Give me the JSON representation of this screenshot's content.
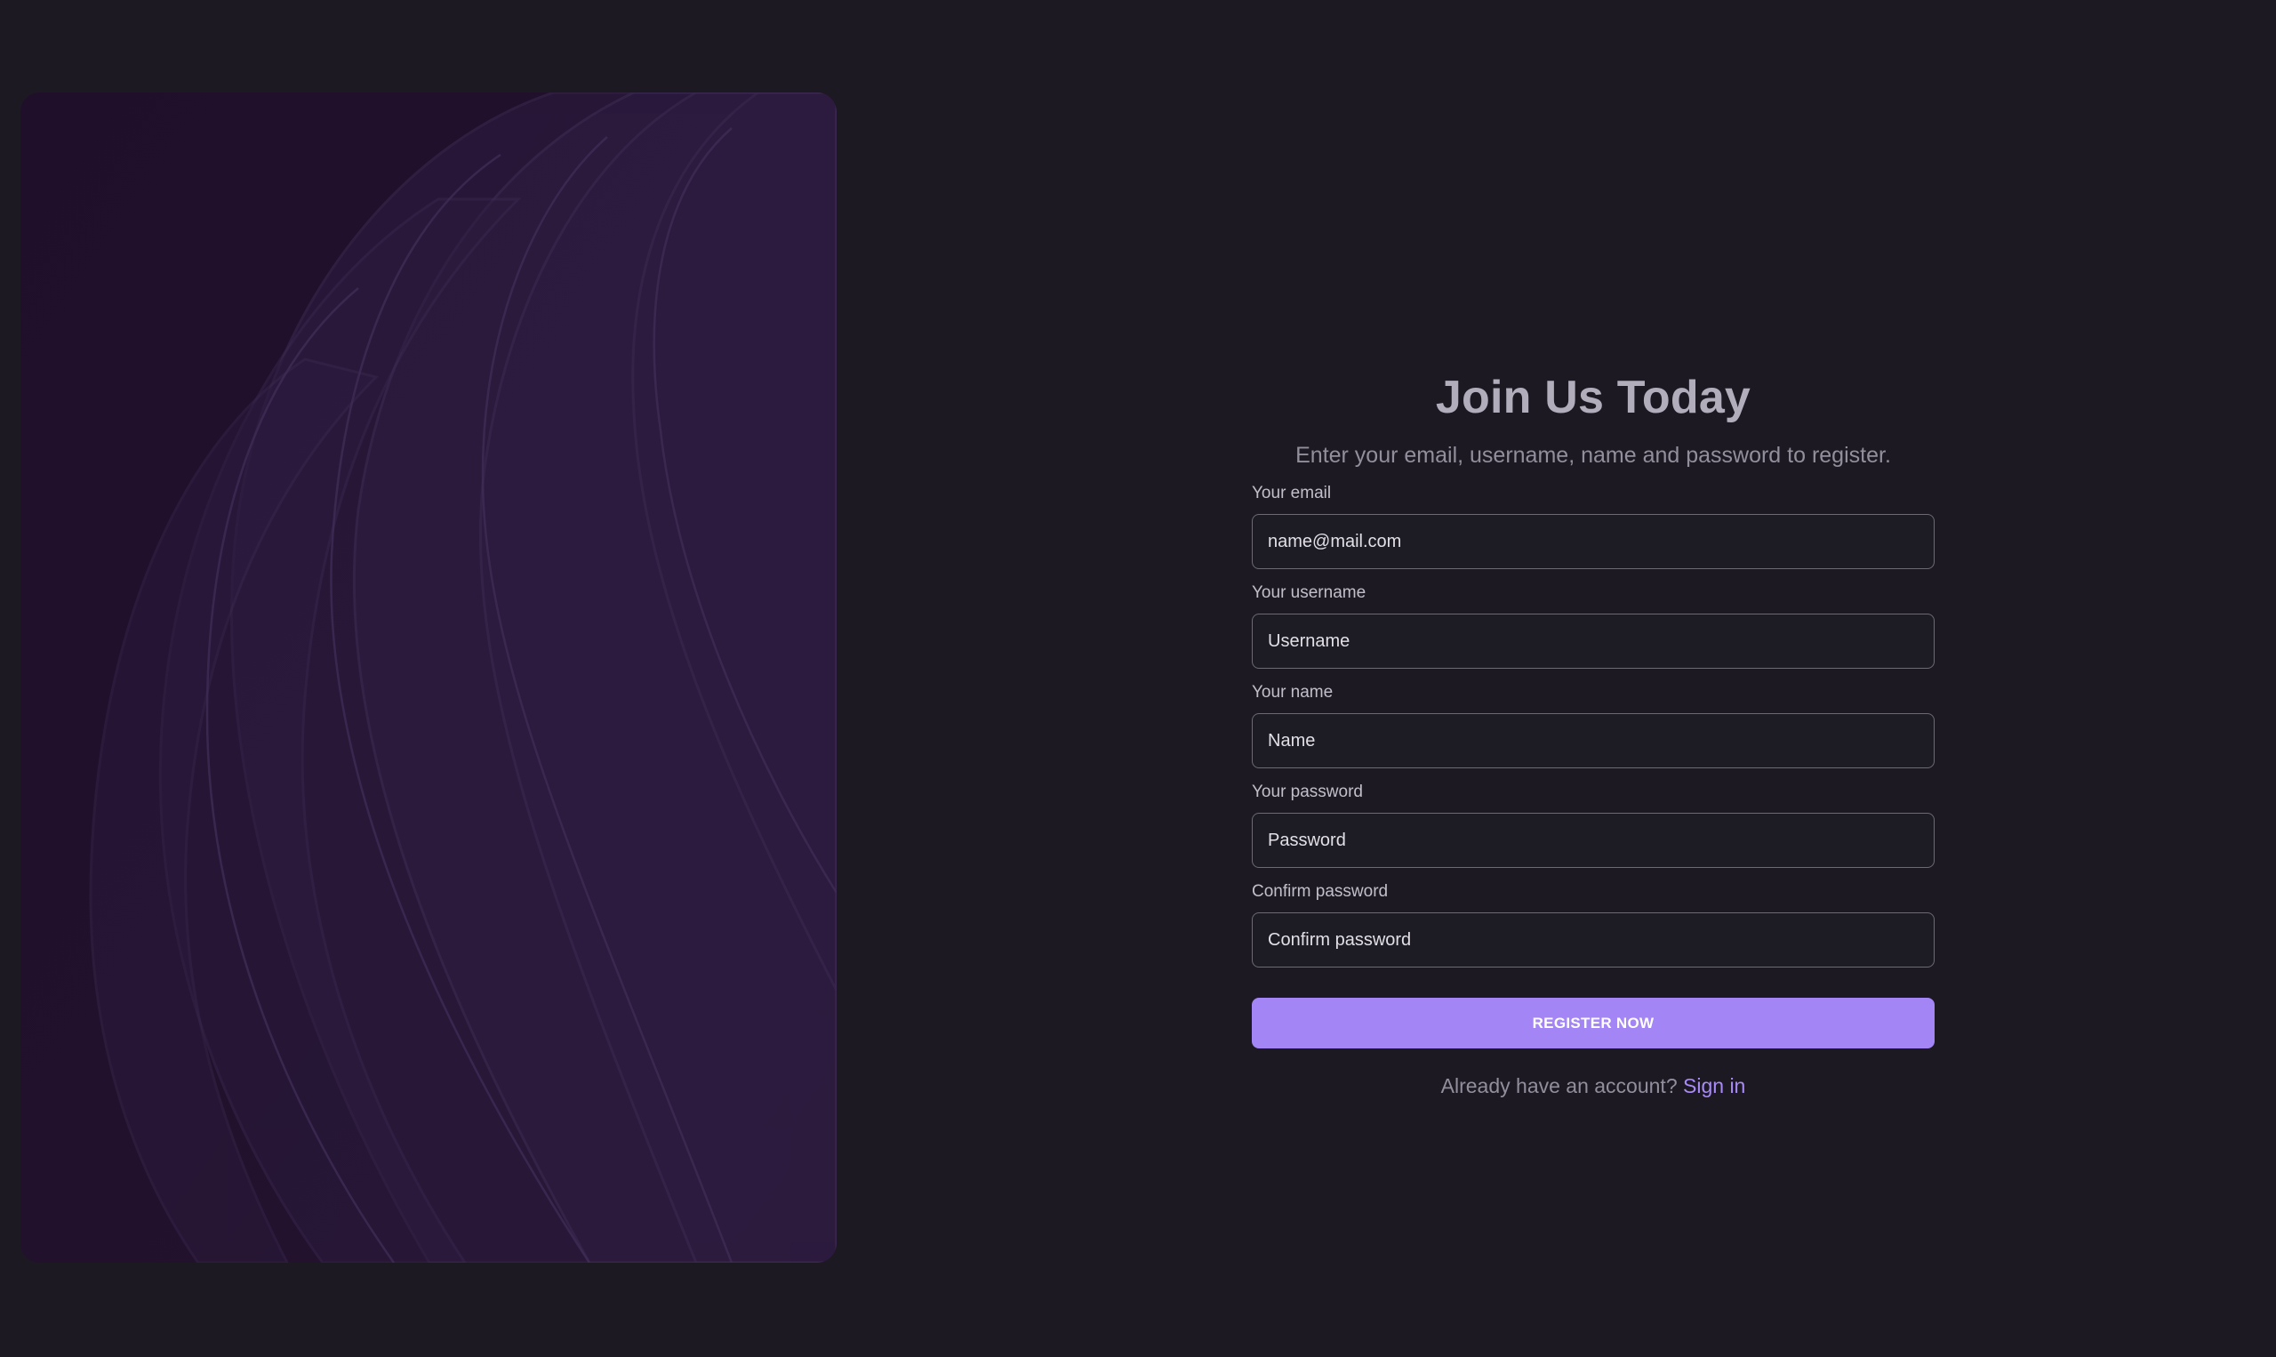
{
  "hero": {
    "image_name": "purple-abstract-waves-image",
    "base_color": "#23132f",
    "band_color": "#2f1e40"
  },
  "header": {
    "title": "Join Us Today",
    "subtitle": "Enter your email, username, name and password to register."
  },
  "form": {
    "email": {
      "label": "Your email",
      "placeholder": "name@mail.com"
    },
    "username": {
      "label": "Your username",
      "placeholder": "Username"
    },
    "name": {
      "label": "Your name",
      "placeholder": "Name"
    },
    "password": {
      "label": "Your password",
      "placeholder": "Password"
    },
    "confirm_password": {
      "label": "Confirm password",
      "placeholder": "Confirm password"
    },
    "submit_label": "REGISTER NOW"
  },
  "footer": {
    "prompt": "Already have an account?",
    "signin_label": "Sign in"
  },
  "colors": {
    "background": "#1c1923",
    "accent": "#a385f6",
    "link": "#a98bf7"
  }
}
